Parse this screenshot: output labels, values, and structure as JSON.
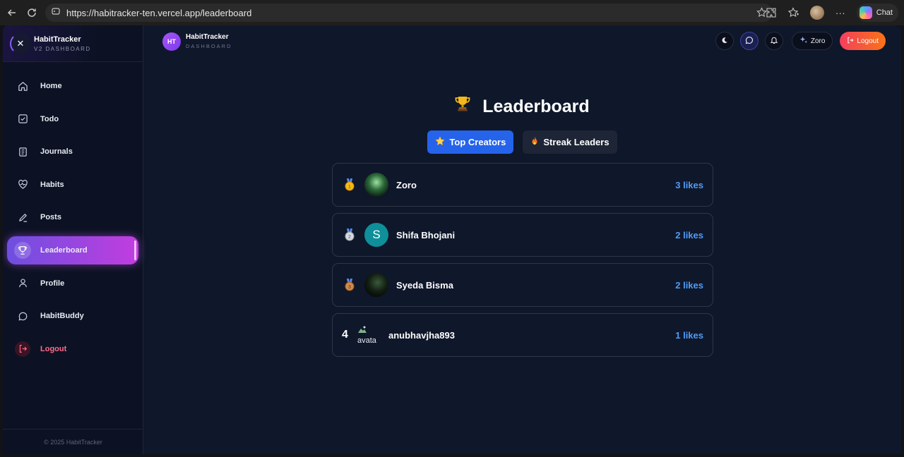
{
  "browser": {
    "url": "https://habitracker-ten.vercel.app/leaderboard",
    "chat_label": "Chat"
  },
  "sidebar": {
    "brand_title": "HabitTracker",
    "brand_subtitle": "V2 DASHBOARD",
    "items": [
      {
        "label": "Home",
        "icon": "home-icon"
      },
      {
        "label": "Todo",
        "icon": "checkbox-icon"
      },
      {
        "label": "Journals",
        "icon": "journal-icon"
      },
      {
        "label": "Habits",
        "icon": "heart-pulse-icon"
      },
      {
        "label": "Posts",
        "icon": "pencil-icon"
      },
      {
        "label": "Leaderboard",
        "icon": "trophy-icon",
        "active": true
      },
      {
        "label": "Profile",
        "icon": "user-icon"
      },
      {
        "label": "HabitBuddy",
        "icon": "chat-bubble-icon"
      },
      {
        "label": "Logout",
        "icon": "logout-icon"
      }
    ],
    "footer": "© 2025 HabitTracker"
  },
  "header": {
    "logo_initials": "HT",
    "title": "HabitTracker",
    "subtitle": "DASHBOARD",
    "user_name": "Zoro",
    "logout_label": "Logout"
  },
  "main": {
    "title": "Leaderboard",
    "tabs": [
      {
        "label": "Top Creators",
        "active": true
      },
      {
        "label": "Streak Leaders",
        "active": false
      }
    ],
    "entries": [
      {
        "rank": "1",
        "name": "Zoro",
        "likes": "3 likes",
        "medal": "gold"
      },
      {
        "rank": "2",
        "name": "Shifa Bhojani",
        "likes": "2 likes",
        "medal": "silver",
        "avatar_letter": "S"
      },
      {
        "rank": "3",
        "name": "Syeda Bisma",
        "likes": "2 likes",
        "medal": "bronze"
      },
      {
        "rank": "4",
        "name": "anubhavjha893",
        "likes": "1 likes",
        "avatar_alt": "avata"
      }
    ]
  },
  "colors": {
    "accent_blue": "#2563eb",
    "likes_blue": "#4f9cf7",
    "active_gradient_start": "#6d4fe0",
    "active_gradient_end": "#c23ddf",
    "logout_gradient_start": "#f43f5e",
    "logout_gradient_end": "#f97316"
  }
}
